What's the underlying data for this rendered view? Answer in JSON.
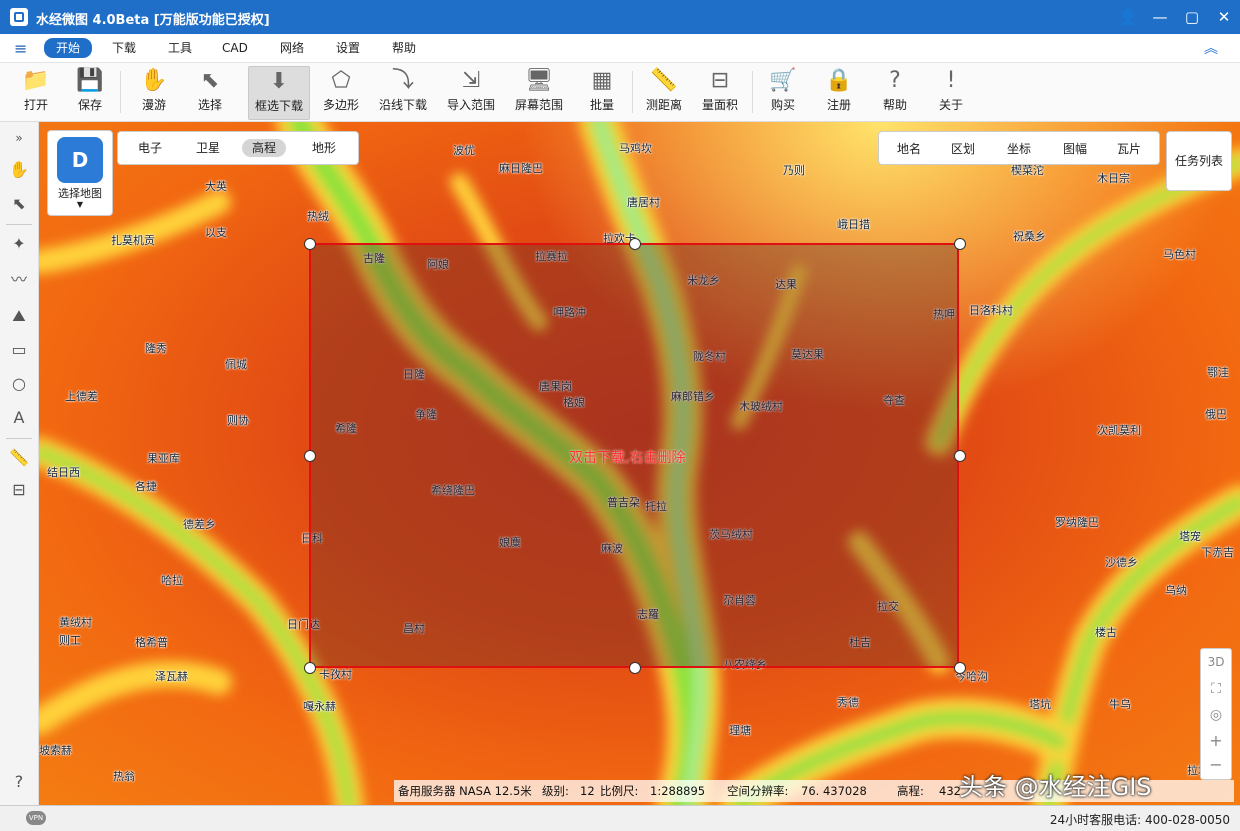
{
  "window": {
    "title": "水经微图 4.0Beta [万能版功能已授权]",
    "controls": {
      "user": "👤",
      "minimize": "—",
      "maximize": "▢",
      "close": "✕"
    }
  },
  "menu": {
    "items": [
      "开始",
      "下载",
      "工具",
      "CAD",
      "网络",
      "设置",
      "帮助"
    ],
    "active": "开始"
  },
  "toolbar": {
    "tools": [
      {
        "label": "打开",
        "icon": "folder-icon",
        "glyph": "📁"
      },
      {
        "label": "保存",
        "icon": "save-icon",
        "glyph": "💾"
      },
      {
        "label": "漫游",
        "icon": "hand-icon",
        "glyph": "✋"
      },
      {
        "label": "选择",
        "icon": "pointer-icon",
        "glyph": "⬉"
      },
      {
        "label": "框选下载",
        "icon": "box-download-icon",
        "glyph": "⬇"
      },
      {
        "label": "多边形",
        "icon": "polygon-icon",
        "glyph": "⬠"
      },
      {
        "label": "沿线下载",
        "icon": "line-download-icon",
        "glyph": "⤵"
      },
      {
        "label": "导入范围",
        "icon": "import-icon",
        "glyph": "⇲"
      },
      {
        "label": "屏幕范围",
        "icon": "screen-icon",
        "glyph": "🖥"
      },
      {
        "label": "批量",
        "icon": "batch-icon",
        "glyph": "▦"
      },
      {
        "label": "测距离",
        "icon": "ruler-icon",
        "glyph": "📏"
      },
      {
        "label": "量面积",
        "icon": "area-icon",
        "glyph": "⊟"
      },
      {
        "label": "购买",
        "icon": "cart-icon",
        "glyph": "🛒"
      },
      {
        "label": "注册",
        "icon": "lock-icon",
        "glyph": "🔒"
      },
      {
        "label": "帮助",
        "icon": "help-icon",
        "glyph": "?"
      },
      {
        "label": "关于",
        "icon": "info-icon",
        "glyph": "!"
      }
    ],
    "active": "框选下载"
  },
  "map": {
    "types": [
      "电子",
      "卫星",
      "高程",
      "地形"
    ],
    "active_type": "高程",
    "overlays": [
      "地名",
      "区划",
      "坐标",
      "图幅",
      "瓦片"
    ],
    "choose_map_label": "选择地图",
    "task_list_label": "任务列表",
    "selection_hint": "双击下载,右击删除",
    "controls": [
      "3D",
      "⛶",
      "◎",
      "+",
      "−"
    ]
  },
  "places": [
    {
      "name": "波优"
    },
    {
      "name": "马鸡坎"
    },
    {
      "name": "麻日隆巴"
    },
    {
      "name": "乃则"
    },
    {
      "name": "大英"
    },
    {
      "name": "唐居村"
    },
    {
      "name": "热绒"
    },
    {
      "name": "峨日措"
    },
    {
      "name": "扎莫机贡"
    },
    {
      "name": "以支"
    },
    {
      "name": "拉欢卡"
    },
    {
      "name": "祝桑乡"
    },
    {
      "name": "古隆"
    },
    {
      "name": "阿娘"
    },
    {
      "name": "拉赛拉"
    },
    {
      "name": "米龙乡"
    },
    {
      "name": "达果"
    },
    {
      "name": "马色村"
    },
    {
      "name": "呷路冲"
    },
    {
      "name": "热呷"
    },
    {
      "name": "日洛科村"
    },
    {
      "name": "隆秀"
    },
    {
      "name": "陇冬村"
    },
    {
      "name": "莫达果"
    },
    {
      "name": "佩城"
    },
    {
      "name": "日隆"
    },
    {
      "name": "唐果岗"
    },
    {
      "name": "上德差"
    },
    {
      "name": "麻郎错乡"
    },
    {
      "name": "格娘"
    },
    {
      "name": "木玻绒村"
    },
    {
      "name": "夺查"
    },
    {
      "name": "则协"
    },
    {
      "name": "争隆"
    },
    {
      "name": "希隆"
    },
    {
      "name": "次凯莫利"
    },
    {
      "name": "果亚库"
    },
    {
      "name": "结日西"
    },
    {
      "name": "各捷"
    },
    {
      "name": "希绕隆巴"
    },
    {
      "name": "普吉朶"
    },
    {
      "name": "托拉"
    },
    {
      "name": "罗纳隆巴"
    },
    {
      "name": "德差乡"
    },
    {
      "name": "日科"
    },
    {
      "name": "娘麋"
    },
    {
      "name": "茨马绒村"
    },
    {
      "name": "沙德乡"
    },
    {
      "name": "麻波"
    },
    {
      "name": "哈拉"
    },
    {
      "name": "乌纳"
    },
    {
      "name": "黄绒村"
    },
    {
      "name": "日门达"
    },
    {
      "name": "则工"
    },
    {
      "name": "格希普"
    },
    {
      "name": "昌村"
    },
    {
      "name": "志羅"
    },
    {
      "name": "尕肖蓉"
    },
    {
      "name": "拉交"
    },
    {
      "name": "杜吉"
    },
    {
      "name": "泽瓦赫"
    },
    {
      "name": "卡孜村"
    },
    {
      "name": "八农绛乡"
    },
    {
      "name": "今哈沟"
    },
    {
      "name": "嘎永赫"
    },
    {
      "name": "秀德"
    },
    {
      "name": "塔坑"
    },
    {
      "name": "牛乌"
    },
    {
      "name": "理塘"
    },
    {
      "name": "坡索赫"
    },
    {
      "name": "热翁"
    },
    {
      "name": "拉塘"
    },
    {
      "name": "木日宗"
    },
    {
      "name": "楔菜沱"
    },
    {
      "name": "鄂洼"
    },
    {
      "name": "俄巴"
    },
    {
      "name": "塔宠"
    },
    {
      "name": "下赤吉"
    },
    {
      "name": "楼古"
    }
  ],
  "status": {
    "server": "备用服务器 NASA 12.5米",
    "level_label": "级别:",
    "level": "12",
    "scale_label": "比例尺:",
    "scale": "1:288895",
    "resolution_label": "空间分辨率:",
    "resolution": "76. 437028",
    "elevation_label": "高程:",
    "elevation": "432",
    "watermark": "头条 @水经注GIS",
    "hotline": "24小时客服电话: 400-028-0050",
    "vpn_badge": "VPN"
  },
  "sidebar_icons": [
    "»",
    "✋",
    "⬉",
    "✦",
    "〰",
    "⛰",
    "▭",
    "○",
    "A",
    "📏",
    "⊟",
    "?"
  ],
  "colors": {
    "title_bar": "#1f6fc8",
    "selection_border": "#e01010",
    "hint_text": "#ff3030"
  }
}
